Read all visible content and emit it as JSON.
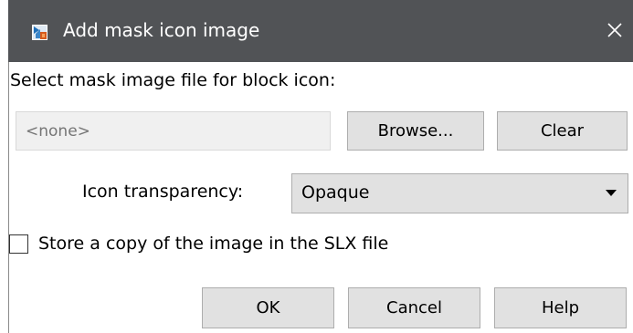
{
  "window": {
    "title": "Add mask icon image",
    "close_glyph": "✕",
    "icon": "mask-image-app-icon"
  },
  "file_section": {
    "label": "Select mask image file for block icon:",
    "field_placeholder": "<none>",
    "browse_label": "Browse...",
    "clear_label": "Clear"
  },
  "transparency": {
    "label": "Icon transparency:",
    "selected": "Opaque"
  },
  "store_copy": {
    "label": "Store a copy of the image in the SLX file",
    "checked": false
  },
  "footer": {
    "ok_label": "OK",
    "cancel_label": "Cancel",
    "help_label": "Help"
  },
  "colors": {
    "titlebar": "#515356",
    "button_face": "#e1e1e1",
    "button_border": "#adadad",
    "field_background": "#f0f0f0",
    "placeholder_text": "#9b9b9b"
  }
}
